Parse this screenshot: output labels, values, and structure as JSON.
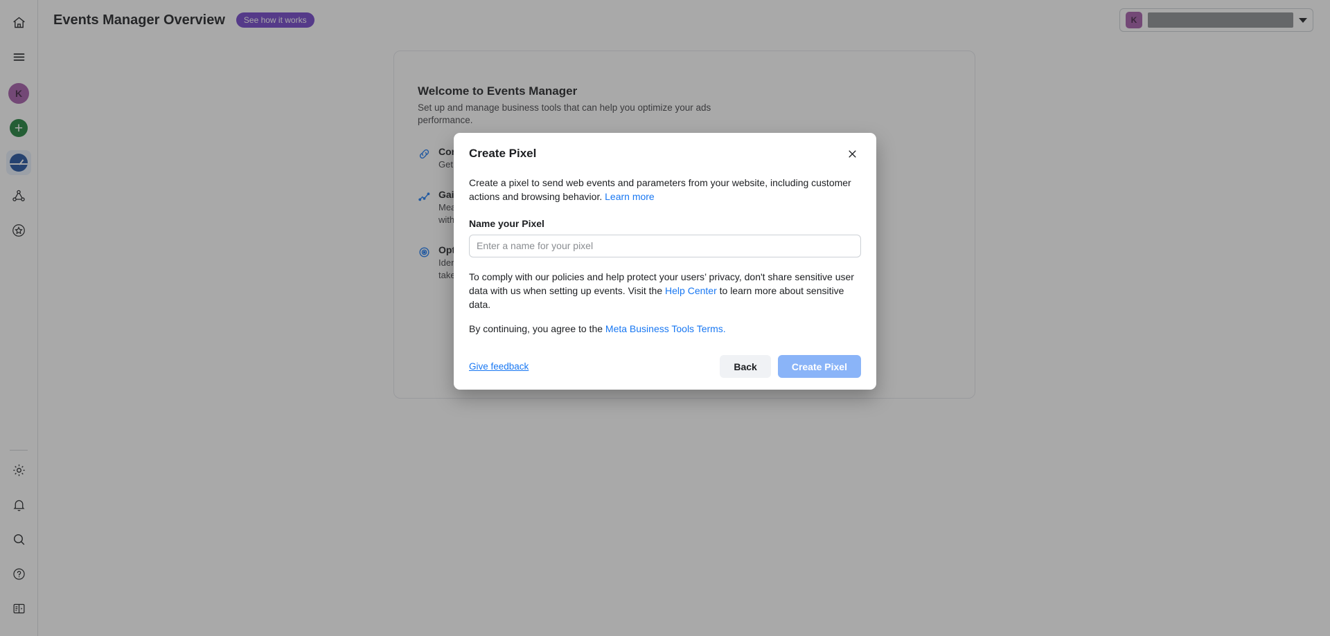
{
  "header": {
    "title": "Events Manager Overview",
    "badge": "See how it works",
    "account": {
      "initial": "K",
      "name_redacted": true
    }
  },
  "sidebar": {
    "top_items": [
      {
        "icon": "home-icon",
        "label": "Home"
      },
      {
        "icon": "menu-icon",
        "label": "Menu"
      },
      {
        "icon": "avatar-icon",
        "label": "K"
      },
      {
        "icon": "plus-icon",
        "label": "Create"
      },
      {
        "icon": "gauge-icon",
        "label": "Events Manager",
        "active": true
      },
      {
        "icon": "network-nodes-icon",
        "label": "Connections"
      },
      {
        "icon": "star-badge-icon",
        "label": "Favorites"
      }
    ],
    "bottom_items": [
      {
        "icon": "gear-icon",
        "label": "Settings"
      },
      {
        "icon": "bell-icon",
        "label": "Notifications"
      },
      {
        "icon": "search-icon",
        "label": "Search"
      },
      {
        "icon": "help-icon",
        "label": "Help"
      },
      {
        "icon": "panel-toggle-icon",
        "label": "Toggle panel"
      }
    ]
  },
  "content": {
    "welcome_title": "Welcome to Events Manager",
    "welcome_subtitle": "Set up and manage business tools that can help you optimize your ads performance.",
    "features": [
      {
        "icon": "link-chain-icon",
        "title": "Connect your data",
        "desc": "Get set up to share website, app, and offline customer data with us."
      },
      {
        "icon": "trend-line-icon",
        "title": "Gain insights",
        "desc": "Measure and understand the actions people take when they interact with your business."
      },
      {
        "icon": "target-icon",
        "title": "Optimize your ads",
        "desc": "Identify new audiences and reach the people who are most likely to take action."
      }
    ]
  },
  "modal": {
    "title": "Create Pixel",
    "close_label": "Close",
    "description_pre": "Create a pixel to send web events and parameters from your website, including customer actions and browsing behavior. ",
    "learn_more": "Learn more",
    "field_label": "Name your Pixel",
    "input_value": "",
    "input_placeholder": "Enter a name for your pixel",
    "policy_pre": "To comply with our policies and help protect your users’ privacy, don't share sensitive user data with us when setting up events. Visit the ",
    "policy_link": "Help Center",
    "policy_post": " to learn more about sensitive data.",
    "terms_pre": "By continuing, you agree to the ",
    "terms_link": "Meta Business Tools Terms.",
    "feedback_label": "Give feedback",
    "back_label": "Back",
    "submit_label": "Create Pixel",
    "submit_disabled": true
  },
  "colors": {
    "accent_blue": "#1877f2",
    "badge_purple": "#6e40c9",
    "avatar_purple": "#a359a8",
    "create_green": "#1a7f37",
    "gauge_blue": "#1d4f9e",
    "primary_disabled": "#8ab4f8"
  }
}
